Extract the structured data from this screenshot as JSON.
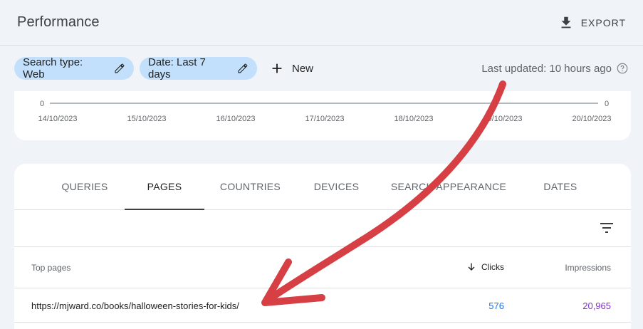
{
  "header": {
    "title": "Performance",
    "export_label": "EXPORT"
  },
  "filters": {
    "search_type": "Search type: Web",
    "date": "Date: Last 7 days",
    "new_label": "New",
    "last_updated": "Last updated: 10 hours ago"
  },
  "chart_data": {
    "type": "line",
    "x": [
      "14/10/2023",
      "15/10/2023",
      "16/10/2023",
      "17/10/2023",
      "18/10/2023",
      "19/10/2023",
      "20/10/2023"
    ],
    "y_left_tick": "0",
    "y_right_tick": "0"
  },
  "tabs": [
    {
      "label": "QUERIES"
    },
    {
      "label": "PAGES"
    },
    {
      "label": "COUNTRIES"
    },
    {
      "label": "DEVICES"
    },
    {
      "label": "SEARCH APPEARANCE"
    },
    {
      "label": "DATES"
    }
  ],
  "active_tab": "PAGES",
  "table": {
    "columns": {
      "pages": "Top pages",
      "clicks": "Clicks",
      "impressions": "Impressions"
    },
    "rows": [
      {
        "url": "https://mjward.co/books/halloween-stories-for-kids/",
        "clicks": "576",
        "impressions": "20,965"
      }
    ]
  },
  "colors": {
    "chip_bg": "#c2e0fb",
    "clicks": "#1a73e8",
    "impressions": "#8430ce",
    "annotation_arrow": "#d64045"
  }
}
